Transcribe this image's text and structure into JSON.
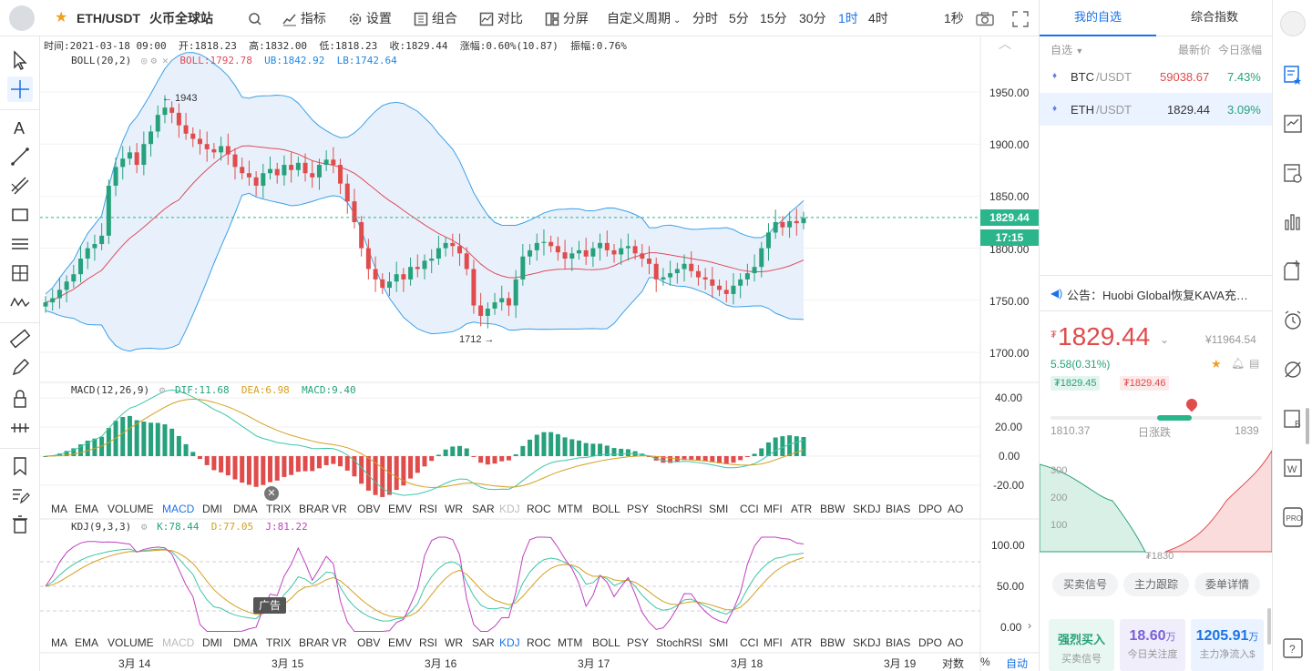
{
  "topbar": {
    "favorite_icon": "star-icon",
    "pair": "ETH/USDT",
    "exchange": "火币全球站",
    "search_icon": "search-icon",
    "indicators": "指标",
    "settings": "设置",
    "combo": "组合",
    "compare": "对比",
    "split": "分屏",
    "custom_period": "自定义周期",
    "periods": [
      "分时",
      "5分",
      "15分",
      "30分",
      "1时",
      "4时"
    ],
    "active_period": "1时",
    "interval_1s": "1秒"
  },
  "ohlc": {
    "time_label": "时间:2021-03-18 09:00",
    "open_label": "开:1818.23",
    "high_label": "高:1832.00",
    "low_label": "低:1818.23",
    "close_label": "收:1829.44",
    "change_label": "涨幅:0.60%(10.87)",
    "amp_label": "振幅:0.76%"
  },
  "boll": {
    "name": "BOLL(20,2)",
    "mid": "BOLL:1792.78",
    "ub": "UB:1842.92",
    "lb": "LB:1742.64"
  },
  "macd": {
    "name": "MACD(12,26,9)",
    "dif": "DIF:11.68",
    "dea": "DEA:6.98",
    "macd": "MACD:9.40"
  },
  "kdj": {
    "name": "KDJ(9,3,3)",
    "k": "K:78.44",
    "d": "D:77.05",
    "j": "J:81.22"
  },
  "price_axis": [
    "1950.00",
    "1900.00",
    "1850.00",
    "1800.00",
    "1750.00",
    "1700.00"
  ],
  "last_price_tag": "1829.44",
  "countdown_tag": "17:15",
  "high_marker": "← 1943",
  "low_marker": "1712 →",
  "macd_axis": [
    "40.00",
    "20.00",
    "0.00",
    "-20.00"
  ],
  "kdj_axis": [
    "100.00",
    "50.00",
    "0.00"
  ],
  "indicator_tabs_1": [
    "MA",
    "EMA",
    "VOLUME",
    "MACD",
    "DMI",
    "DMA",
    "TRIX",
    "BRAR",
    "VR",
    "OBV",
    "EMV",
    "RSI",
    "WR",
    "SAR",
    "KDJ",
    "ROC",
    "MTM",
    "BOLL",
    "PSY",
    "StochRSI",
    "SMI",
    "CCI",
    "MFI",
    "ATR",
    "BBW",
    "SKDJ",
    "BIAS",
    "DPO",
    "AO"
  ],
  "indicator_tabs_2": [
    "MA",
    "EMA",
    "VOLUME",
    "MACD",
    "DMI",
    "DMA",
    "TRIX",
    "BRAR",
    "VR",
    "OBV",
    "EMV",
    "RSI",
    "WR",
    "SAR",
    "KDJ",
    "ROC",
    "MTM",
    "BOLL",
    "PSY",
    "StochRSI",
    "SMI",
    "CCI",
    "MFI",
    "ATR",
    "BBW",
    "SKDJ",
    "BIAS",
    "DPO",
    "AO"
  ],
  "ad_label": "广告",
  "date_axis": [
    "3月 14",
    "3月 15",
    "3月 16",
    "3月 17",
    "3月 18",
    "3月 19"
  ],
  "bottom_controls": {
    "log": "对数",
    "percent": "%",
    "auto": "自动"
  },
  "watch": {
    "tab_mine": "我的自选",
    "tab_index": "综合指数",
    "col_name": "自选",
    "col_price": "最新价",
    "col_change": "今日涨幅",
    "rows": [
      {
        "base": "BTC",
        "quote": "/USDT",
        "price": "59038.67",
        "change": "7.43%"
      },
      {
        "base": "ETH",
        "quote": "/USDT",
        "price": "1829.44",
        "change": "3.09%"
      }
    ],
    "notice": "公告：Huobi Global恢复KAVA充…",
    "price_symbol": "₮",
    "price": "1829.44",
    "cny": "¥11964.54",
    "delta": "5.58(0.31%)",
    "bid": "₮1829.45",
    "ask": "₮1829.46",
    "range_low": "1810.37",
    "range_label": "日涨跌",
    "range_high": "1839",
    "depth_axis": [
      "300",
      "200",
      "100"
    ],
    "depth_mid": "₮1830",
    "tab_signal": "买卖信号",
    "tab_main": "主力跟踪",
    "tab_orders": "委单详情",
    "signal_value": "强烈买入",
    "signal_label": "买卖信号",
    "attention_value": "18.60",
    "attention_unit": "万",
    "attention_label": "今日关注度",
    "inflow_value": "1205.91",
    "inflow_unit": "万",
    "inflow_label": "主力净流入$"
  },
  "colors": {
    "up": "#26a17b",
    "down": "#e04b4b",
    "accent": "#1a73e8",
    "boll_fill": "#e6f0fb",
    "boll_band": "#3aa0e8",
    "boll_mid": "#e04b5a"
  }
}
